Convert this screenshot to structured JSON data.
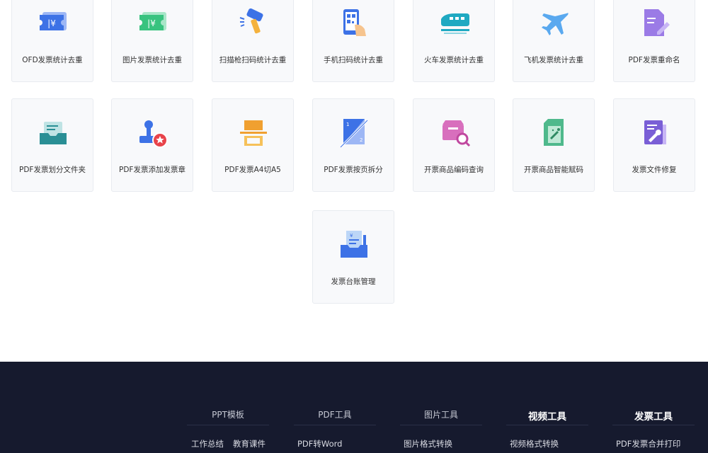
{
  "tools": [
    {
      "label": "OFD发票统计去重",
      "icon": "ofd-invoice-icon"
    },
    {
      "label": "图片发票统计去重",
      "icon": "image-invoice-icon"
    },
    {
      "label": "扫描枪扫码统计去重",
      "icon": "barcode-scanner-icon"
    },
    {
      "label": "手机扫码统计去重",
      "icon": "phone-scan-icon"
    },
    {
      "label": "火车发票统计去重",
      "icon": "train-icon"
    },
    {
      "label": "飞机发票统计去重",
      "icon": "airplane-icon"
    },
    {
      "label": "PDF发票重命名",
      "icon": "rename-edit-icon"
    },
    {
      "label": "PDF发票划分文件夹",
      "icon": "folder-split-icon"
    },
    {
      "label": "PDF发票添加发票章",
      "icon": "stamp-icon"
    },
    {
      "label": "PDF发票A4切A5",
      "icon": "a4-cut-a5-icon"
    },
    {
      "label": "PDF发票按页拆分",
      "icon": "page-split-icon"
    },
    {
      "label": "开票商品编码查询",
      "icon": "product-code-search-icon"
    },
    {
      "label": "开票商品智能赋码",
      "icon": "smart-coding-icon"
    },
    {
      "label": "发票文件修复",
      "icon": "file-repair-icon"
    },
    {
      "label": "发票台账管理",
      "icon": "ledger-icon"
    }
  ],
  "footer": {
    "columns": [
      {
        "title": "PPT模板",
        "links": [
          "工作总结",
          "教育课件"
        ]
      },
      {
        "title": "PDF工具",
        "links": [
          "PDF转Word"
        ]
      },
      {
        "title": "图片工具",
        "links": [
          "图片格式转换"
        ]
      },
      {
        "title": "视频工具",
        "links": [
          "视频格式转换"
        ]
      },
      {
        "title": "发票工具",
        "links": [
          "PDF发票合并打印"
        ]
      }
    ]
  },
  "colors": {
    "footer_bg": "#161a2e",
    "tile_bg": "#f8f9fb",
    "tile_border": "#e8ebf0",
    "blue": "#3d72e6",
    "green": "#38c37f",
    "teal": "#1fa9c2"
  }
}
